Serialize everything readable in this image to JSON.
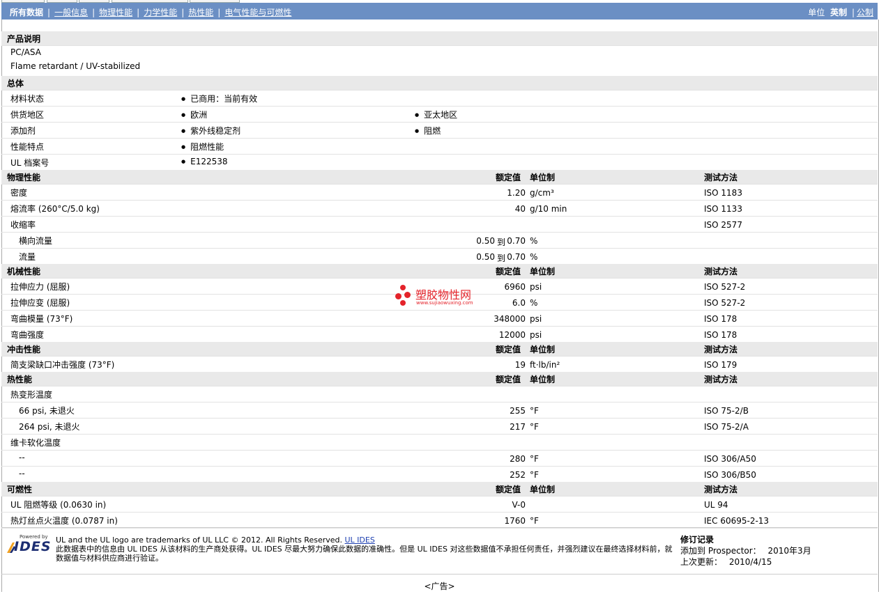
{
  "nav": {
    "tabs": [
      {
        "label": "所有数据",
        "active": true
      },
      {
        "label": "一般信息"
      },
      {
        "label": "物理性能"
      },
      {
        "label": "力学性能"
      },
      {
        "label": "热性能"
      },
      {
        "label": "电气性能与可燃性"
      }
    ],
    "units_label": "单位",
    "unit_imperial": "英制",
    "unit_metric": "公制"
  },
  "product": {
    "header": "产品说明",
    "lines": [
      "PC/ASA",
      "Flame retardant / UV-stabilized"
    ]
  },
  "general": {
    "header": "总体",
    "rows": [
      {
        "label": "材料状态",
        "v1": "已商用：当前有效",
        "v2": ""
      },
      {
        "label": "供货地区",
        "v1": "欧洲",
        "v2": "亚太地区"
      },
      {
        "label": "添加剂",
        "v1": "紫外线稳定剂",
        "v2": "阻燃"
      },
      {
        "label": "性能特点",
        "v1": "阻燃性能",
        "v2": ""
      },
      {
        "label": "UL 档案号",
        "v1": "E122538",
        "v2": ""
      }
    ]
  },
  "columns": {
    "nominal": "额定值",
    "unit": "单位制",
    "method": "测试方法"
  },
  "range_word": "到",
  "sections": [
    {
      "header": "物理性能",
      "rows": [
        {
          "label": "密度",
          "value": "1.20",
          "unit": "g/cm³",
          "method": "ISO 1183"
        },
        {
          "label": "熔流率 (260°C/5.0 kg)",
          "value": "40",
          "unit": "g/10 min",
          "method": "ISO 1133"
        },
        {
          "label": "收缩率",
          "value": "",
          "unit": "",
          "method": "ISO 2577"
        },
        {
          "label": "横向流量",
          "indent": true,
          "value_from": "0.50",
          "value_to": "0.70",
          "unit": "%",
          "method": ""
        },
        {
          "label": "流量",
          "indent": true,
          "value_from": "0.50",
          "value_to": "0.70",
          "unit": "%",
          "method": ""
        }
      ]
    },
    {
      "header": "机械性能",
      "rows": [
        {
          "label": "拉伸应力 (屈服)",
          "value": "6960",
          "unit": "psi",
          "method": "ISO 527-2"
        },
        {
          "label": "拉伸应变 (屈服)",
          "value": "6.0",
          "unit": "%",
          "method": "ISO 527-2"
        },
        {
          "label": "弯曲模量 (73°F)",
          "value": "348000",
          "unit": "psi",
          "method": "ISO 178"
        },
        {
          "label": "弯曲强度",
          "value": "12000",
          "unit": "psi",
          "method": "ISO 178"
        }
      ]
    },
    {
      "header": "冲击性能",
      "rows": [
        {
          "label": "简支梁缺口冲击强度 (73°F)",
          "value": "19",
          "unit": "ft·lb/in²",
          "method": "ISO 179"
        }
      ]
    },
    {
      "header": "热性能",
      "rows": [
        {
          "label": "热变形温度",
          "value": "",
          "unit": "",
          "method": ""
        },
        {
          "label": "66 psi, 未退火",
          "indent": true,
          "value": "255",
          "unit": "°F",
          "method": "ISO 75-2/B"
        },
        {
          "label": "264 psi, 未退火",
          "indent": true,
          "value": "217",
          "unit": "°F",
          "method": "ISO 75-2/A"
        },
        {
          "label": "维卡软化温度",
          "value": "",
          "unit": "",
          "method": ""
        },
        {
          "label": "--",
          "indent": true,
          "value": "280",
          "unit": "°F",
          "method": "ISO 306/A50"
        },
        {
          "label": "--",
          "indent": true,
          "value": "252",
          "unit": "°F",
          "method": "ISO 306/B50"
        }
      ]
    },
    {
      "header": "可燃性",
      "rows": [
        {
          "label": "UL 阻燃等级 (0.0630 in)",
          "value": "V-0",
          "unit": "",
          "method": "UL 94"
        },
        {
          "label": "热灯丝点火温度 (0.0787 in)",
          "value": "1760",
          "unit": "°F",
          "method": "IEC 60695-2-13"
        }
      ]
    }
  ],
  "watermark": {
    "title": "塑胶物性网",
    "url": "www.sujiaowuxing.com"
  },
  "footer": {
    "logo_small": "Powered by",
    "logo_big": "IDES",
    "trademark": "UL and the UL logo are trademarks of UL LLC © 2012. All Rights Reserved.",
    "ul_link": "UL IDES",
    "disclaimer": "此数据表中的信息由 UL IDES 从该材料的生产商处获得。UL IDES 尽最大努力确保此数据的准确性。但是 UL IDES 对这些数据值不承担任何责任，并强烈建议在最终选择材料前，就数据值与材料供应商进行验证。",
    "revision_title": "修订记录",
    "added_label": "添加到 Prospector：",
    "added_value": "2010年3月",
    "updated_label": "上次更新：",
    "updated_value": "2010/4/15"
  },
  "ad_label": "<广告>"
}
